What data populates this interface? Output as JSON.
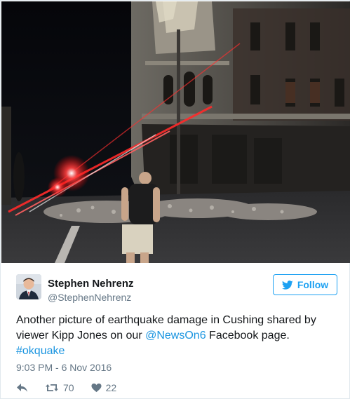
{
  "tweet": {
    "author_name": "Stephen Nehrenz",
    "author_handle": "@StephenNehrenz",
    "follow_label": "Follow",
    "text_part1": "Another picture of earthquake damage in Cushing shared by viewer Kipp Jones on our ",
    "mention": "@NewsOn6",
    "text_part2": " Facebook page. ",
    "hashtag": "#okquake",
    "timestamp": "9:03 PM - 6 Nov 2016",
    "retweet_count": "70",
    "like_count": "22"
  },
  "colors": {
    "accent": "#1da1f2",
    "link": "#1b95e0",
    "secondary_text": "#657786",
    "border": "#e1e8ed"
  },
  "icons": {
    "follow": "twitter-bird-icon",
    "reply": "reply-icon",
    "retweet": "retweet-icon",
    "like": "heart-icon"
  }
}
